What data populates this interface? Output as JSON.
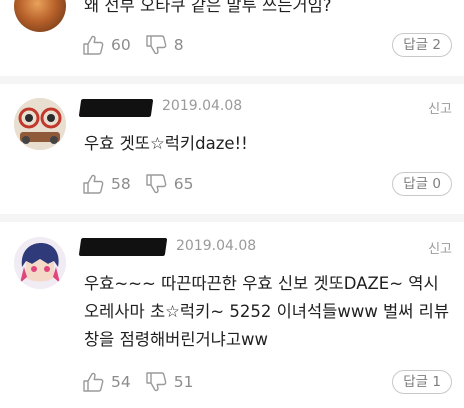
{
  "comments": [
    {
      "text": "왜 선부 오타쿠 같은 말투 쓰는거임?",
      "likes": "60",
      "dislikes": "8",
      "reply_label": "답글 2"
    },
    {
      "date": "2019.04.08",
      "report": "신고",
      "text": "우효 겟또☆럭키daze!!",
      "likes": "58",
      "dislikes": "65",
      "reply_label": "답글 0"
    },
    {
      "date": "2019.04.08",
      "report": "신고",
      "text": "우효~~~ 따끈따끈한 우효 신보 겟또DAZE~ 역시 오레사마 초☆럭키~ 5252 이녀석들www 벌써 리뷰창을 점령해버린거냐고ww",
      "likes": "54",
      "dislikes": "51",
      "reply_label": "답글 1"
    }
  ],
  "icons": {
    "like": "thumbs-up-outline-icon",
    "dislike": "thumbs-down-outline-icon"
  },
  "colors": {
    "muted_text": "#9a9a9a",
    "count_text": "#8c8c8c",
    "button_border": "#c9c9c9"
  }
}
